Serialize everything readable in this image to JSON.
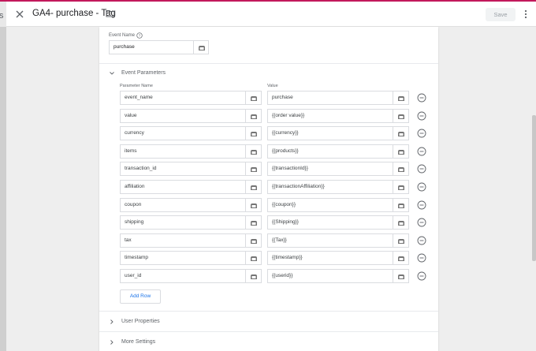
{
  "left_edge": {
    "char": "s"
  },
  "header": {
    "title": "GA4- purchase - Tag",
    "save_label": "Save",
    "icons": {
      "close": "close-icon",
      "folder": "folder-icon",
      "more": "more-vert-icon"
    }
  },
  "event_name": {
    "label": "Event Name",
    "value": "purchase"
  },
  "event_parameters": {
    "label": "Event Parameters",
    "col_name": "Parameter Name",
    "col_value": "Value",
    "rows": [
      {
        "name": "event_name",
        "value": "purchase"
      },
      {
        "name": "value",
        "value": "{{order value}}"
      },
      {
        "name": "currency",
        "value": "{{currency}}"
      },
      {
        "name": "items",
        "value": "{{products}}"
      },
      {
        "name": "transaction_id",
        "value": "{{transactionId}}"
      },
      {
        "name": "affiliation",
        "value": "{{transactionAffiliation}}"
      },
      {
        "name": "coupon",
        "value": "{{coupon}}"
      },
      {
        "name": "shipping",
        "value": "{{Shipping}}"
      },
      {
        "name": "tax",
        "value": "{{Tax}}"
      },
      {
        "name": "timestamp",
        "value": "{{timestamp}}"
      },
      {
        "name": "user_id",
        "value": "{{userid}}"
      }
    ],
    "add_row_label": "Add Row"
  },
  "user_properties": {
    "label": "User Properties"
  },
  "more_settings": {
    "label": "More Settings"
  },
  "colors": {
    "accent": "#1a73e8",
    "top_stripe": "#c2185b"
  }
}
